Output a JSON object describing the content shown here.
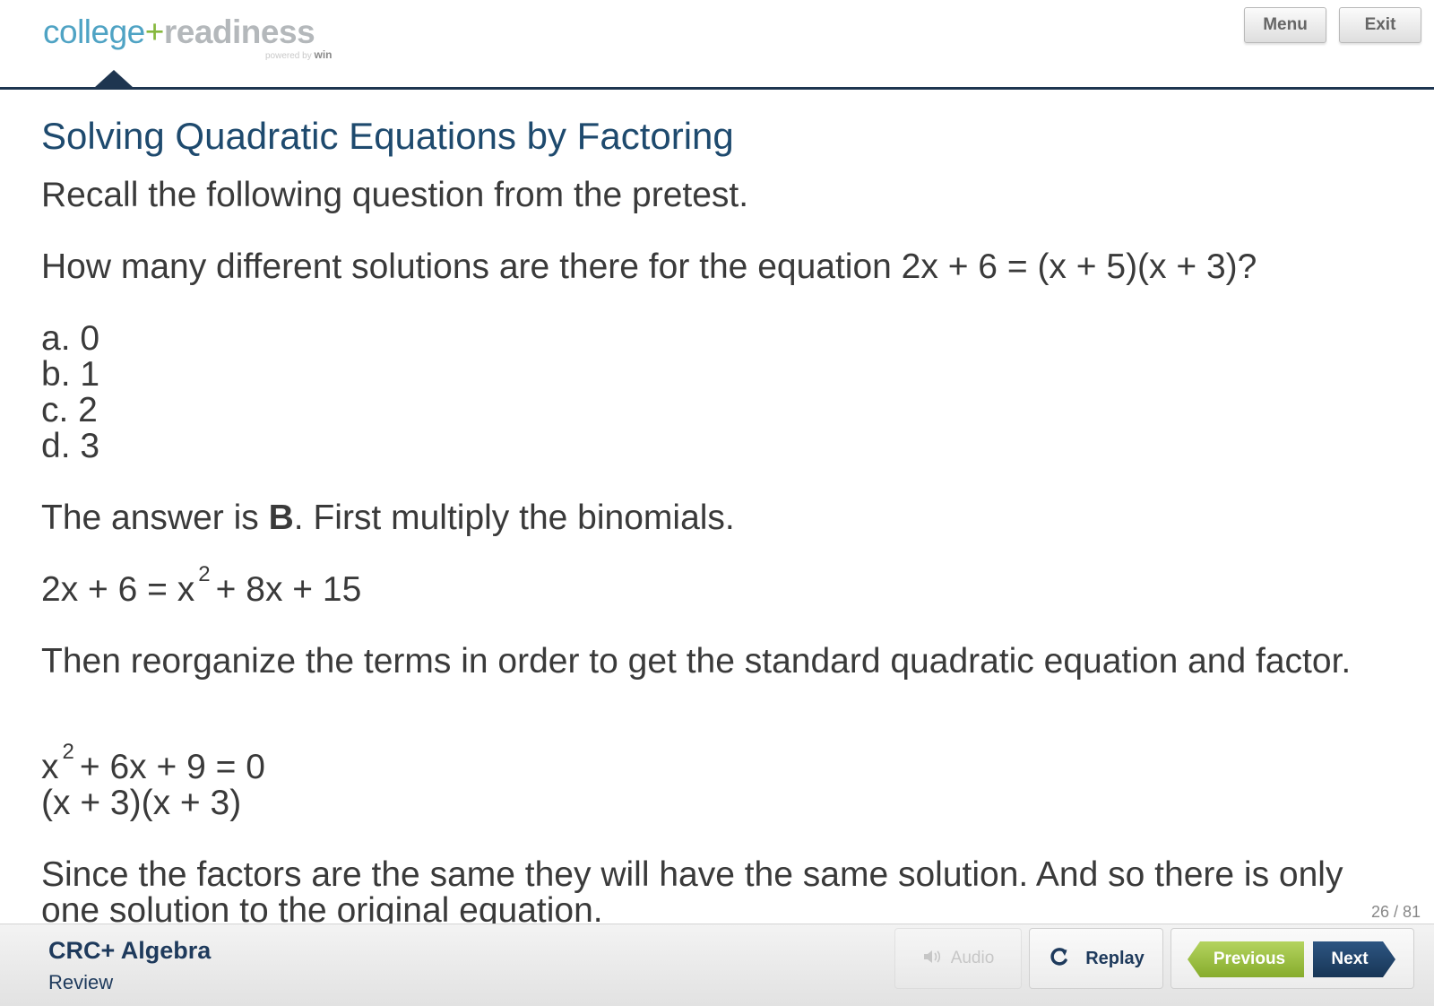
{
  "app": {
    "logo": {
      "college": "college",
      "plus": "+",
      "readiness": "readiness",
      "powered_by": "powered by",
      "win": "win"
    },
    "menu_label": "Menu",
    "exit_label": "Exit"
  },
  "lesson": {
    "title": "Solving Quadratic Equations by Factoring",
    "intro": "Recall the following question from the pretest.",
    "question": "How many different solutions are there for the equation 2x + 6 = (x + 5)(x + 3)?",
    "options": [
      "a. 0",
      "b. 1",
      "c. 2",
      "d. 3"
    ],
    "answer_prefix": "The answer is ",
    "answer_letter": "B",
    "answer_suffix": ". First multiply the binomials.",
    "equation1_left": "2x + 6 = x",
    "equation1_exp": "2",
    "equation1_right": "+ 8x + 15",
    "reorganize_text": "Then reorganize the terms in order to get the standard quadratic equation and factor.",
    "equation2_left": "x",
    "equation2_exp": "2",
    "equation2_right": "+ 6x + 9 = 0",
    "factored": "(x + 3)(x + 3)",
    "conclusion": "Since the factors are the same they will have the same solution. And so there is only one solution to the original equation."
  },
  "page_counter": "26 / 81",
  "footer": {
    "course_title": "CRC+ Algebra",
    "course_subtitle": "Review",
    "audio_label": "Audio",
    "replay_label": "Replay",
    "previous_label": "Previous",
    "next_label": "Next"
  },
  "colors": {
    "title": "#1e4a6e",
    "header_rule": "#1e3550",
    "previous_button": "#9bc13e",
    "next_button": "#1f4068"
  },
  "icons": [
    "speaker-icon",
    "replay-icon"
  ]
}
